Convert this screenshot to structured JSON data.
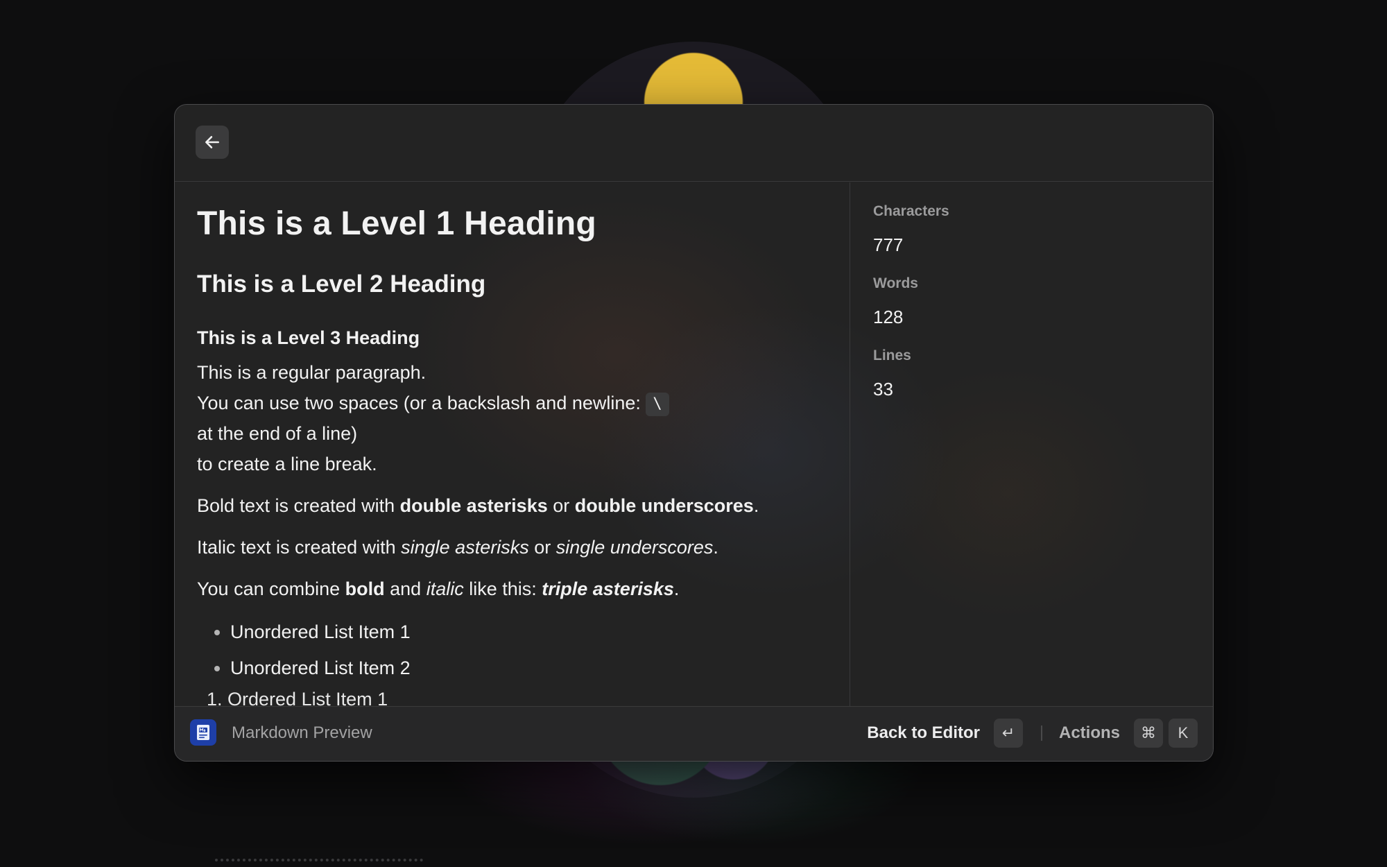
{
  "preview": {
    "h1": "This is a Level 1 Heading",
    "h2": "This is a Level 2 Heading",
    "h3": "This is a Level 3 Heading",
    "para1": {
      "line1": "This is a regular paragraph.",
      "line2": "You can use two spaces (or a backslash and newline: ",
      "code": "\\",
      "line3": "at the end of a line)",
      "line4": "to create a line break."
    },
    "bold_para": {
      "prefix": "Bold text is created with ",
      "bold1": "double asterisks",
      "middle": " or ",
      "bold2": "double underscores",
      "suffix": "."
    },
    "italic_para": {
      "prefix": "Italic text is created with ",
      "italic1": "single asterisks",
      "middle": " or ",
      "italic2": "single underscores",
      "suffix": "."
    },
    "combo_para": {
      "prefix": "You can combine ",
      "bold": "bold",
      "and": " and ",
      "italic": "italic",
      "like": " like this: ",
      "bold_italic": "triple asterisks",
      "suffix": "."
    },
    "list_items": [
      "Unordered List Item 1",
      "Unordered List Item 2"
    ],
    "cut_off_line": "1.   Ordered List Item 1"
  },
  "stats": [
    {
      "label": "Characters",
      "value": "777"
    },
    {
      "label": "Words",
      "value": "128"
    },
    {
      "label": "Lines",
      "value": "33"
    }
  ],
  "footer": {
    "title": "Markdown Preview",
    "back_to_editor": "Back to Editor",
    "enter_key": "↵",
    "actions": "Actions",
    "cmd_key": "⌘",
    "k_key": "K"
  },
  "icons": {
    "back": "arrow-left-icon",
    "app": "markdown-document-icon"
  },
  "colors": {
    "window_bg": "#232323",
    "app_icon": "#1e3fa8",
    "text": "#f2f2f2",
    "muted": "#9b9b9c"
  }
}
